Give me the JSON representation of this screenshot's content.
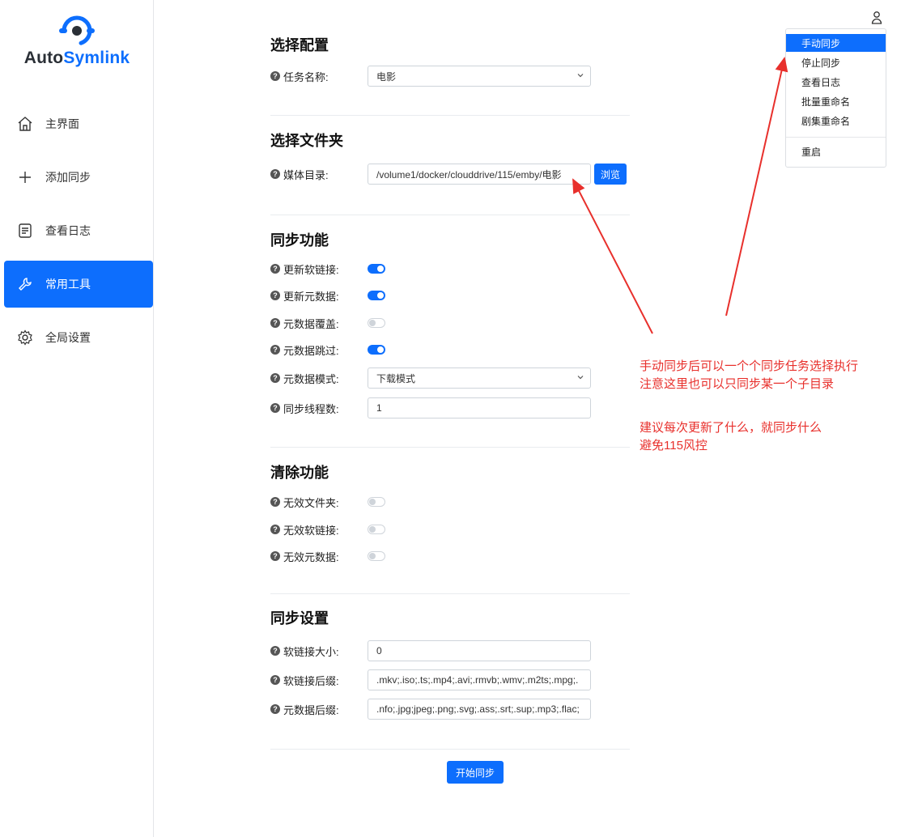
{
  "brand": {
    "name_part1": "Auto",
    "name_part2": "Symlink"
  },
  "sidebar": {
    "items": [
      {
        "label": "主界面",
        "icon": "home-icon"
      },
      {
        "label": "添加同步",
        "icon": "plus-icon"
      },
      {
        "label": "查看日志",
        "icon": "log-icon"
      },
      {
        "label": "常用工具",
        "icon": "wrench-icon",
        "active": true
      },
      {
        "label": "全局设置",
        "icon": "gear-icon"
      }
    ]
  },
  "sections": {
    "config": {
      "title": "选择配置",
      "task_label": "任务名称:",
      "task_value": "电影"
    },
    "folder": {
      "title": "选择文件夹",
      "media_label": "媒体目录:",
      "media_value": "/volume1/docker/clouddrive/115/emby/电影",
      "browse": "浏览"
    },
    "sync": {
      "title": "同步功能",
      "update_symlink_label": "更新软链接:",
      "update_symlink_on": true,
      "update_meta_label": "更新元数据:",
      "update_meta_on": true,
      "meta_overwrite_label": "元数据覆盖:",
      "meta_overwrite_on": false,
      "meta_skip_label": "元数据跳过:",
      "meta_skip_on": true,
      "meta_mode_label": "元数据模式:",
      "meta_mode_value": "下载模式",
      "threads_label": "同步线程数:",
      "threads_value": "1"
    },
    "clean": {
      "title": "清除功能",
      "invalid_folder_label": "无效文件夹:",
      "invalid_folder_on": false,
      "invalid_symlink_label": "无效软链接:",
      "invalid_symlink_on": false,
      "invalid_meta_label": "无效元数据:",
      "invalid_meta_on": false
    },
    "settings": {
      "title": "同步设置",
      "symlink_size_label": "软链接大小:",
      "symlink_size_value": "0",
      "symlink_ext_label": "软链接后缀:",
      "symlink_ext_value": ".mkv;.iso;.ts;.mp4;.avi;.rmvb;.wmv;.m2ts;.mpg;.",
      "meta_ext_label": "元数据后缀:",
      "meta_ext_value": ".nfo;.jpg;jpeg;.png;.svg;.ass;.srt;.sup;.mp3;.flac;"
    }
  },
  "submit_label": "开始同步",
  "user_menu": {
    "items": [
      "手动同步",
      "停止同步",
      "查看日志",
      "批量重命名",
      "剧集重命名",
      "重启"
    ],
    "active_index": 0
  },
  "annotations": {
    "line1": "手动同步后可以一个个同步任务选择执行",
    "line2": "注意这里也可以只同步某一个子目录",
    "line3": "建议每次更新了什么，就同步什么",
    "line4": "避免115风控"
  },
  "colors": {
    "accent": "#0d6efd",
    "annotation": "#e8302c"
  }
}
